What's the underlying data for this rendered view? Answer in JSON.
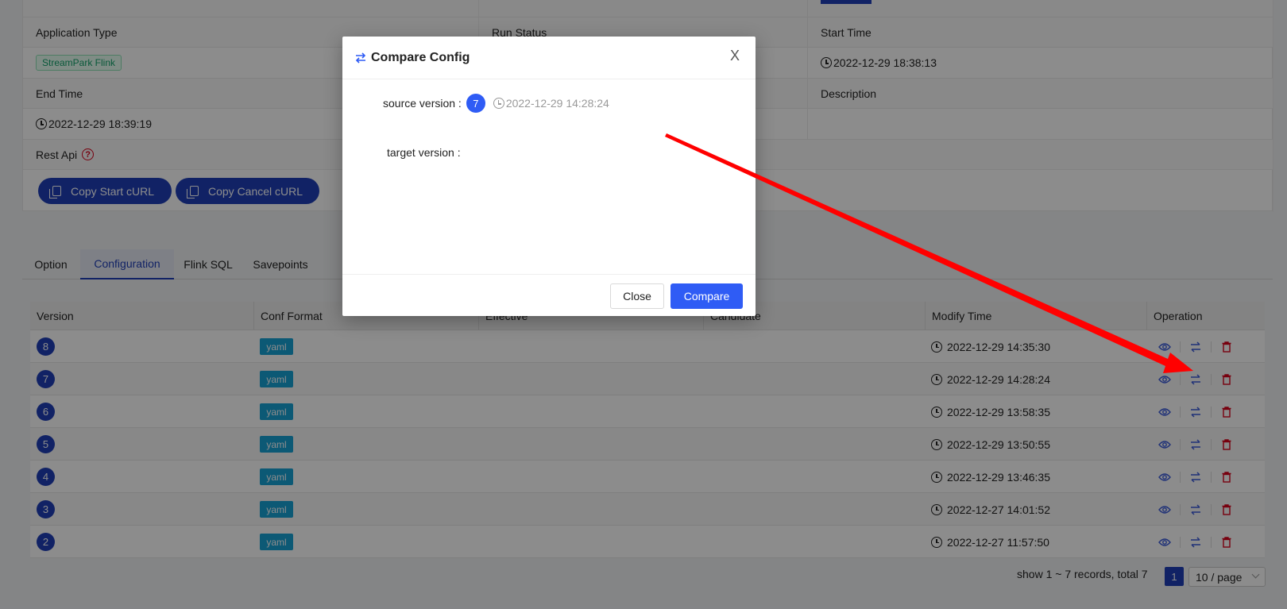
{
  "details": {
    "application_type_label": "Application Type",
    "application_type_value": "StreamPark Flink",
    "run_status_label": "Run Status",
    "start_time_label": "Start Time",
    "start_time_value": "2022-12-29 18:38:13",
    "end_time_label": "End Time",
    "end_time_value": "2022-12-29 18:39:19",
    "description_label": "Description",
    "rest_api_label": "Rest Api",
    "rest_api_help": "?",
    "copy_start_label": "Copy Start cURL",
    "copy_cancel_label": "Copy Cancel cURL"
  },
  "tabs": [
    {
      "label": "Option"
    },
    {
      "label": "Configuration"
    },
    {
      "label": "Flink SQL"
    },
    {
      "label": "Savepoints"
    }
  ],
  "table": {
    "headers": [
      "Version",
      "Conf Format",
      "Effective",
      "Candidate",
      "Modify Time",
      "Operation"
    ],
    "rows": [
      {
        "version": "8",
        "format": "yaml",
        "modify_time": "2022-12-29 14:35:30"
      },
      {
        "version": "7",
        "format": "yaml",
        "modify_time": "2022-12-29 14:28:24"
      },
      {
        "version": "6",
        "format": "yaml",
        "modify_time": "2022-12-29 13:58:35"
      },
      {
        "version": "5",
        "format": "yaml",
        "modify_time": "2022-12-29 13:50:55"
      },
      {
        "version": "4",
        "format": "yaml",
        "modify_time": "2022-12-29 13:46:35"
      },
      {
        "version": "3",
        "format": "yaml",
        "modify_time": "2022-12-27 14:01:52"
      },
      {
        "version": "2",
        "format": "yaml",
        "modify_time": "2022-12-27 11:57:50"
      }
    ]
  },
  "pagination": {
    "summary": "show 1 ~ 7 records, total 7",
    "current_page": "1",
    "page_size": "10 / page"
  },
  "modal": {
    "title": "Compare Config",
    "close_glyph": "X",
    "source_label": "source version :",
    "source_version": "7",
    "source_time": "2022-12-29 14:28:24",
    "target_label": "target version :",
    "close_button": "Close",
    "compare_button": "Compare"
  },
  "colors": {
    "primary": "#1f3fb8",
    "modal_primary": "#2f5cf5",
    "yaml_tag": "#17a2d6",
    "delete": "#d9001b",
    "annotation_arrow": "#ff0000"
  }
}
